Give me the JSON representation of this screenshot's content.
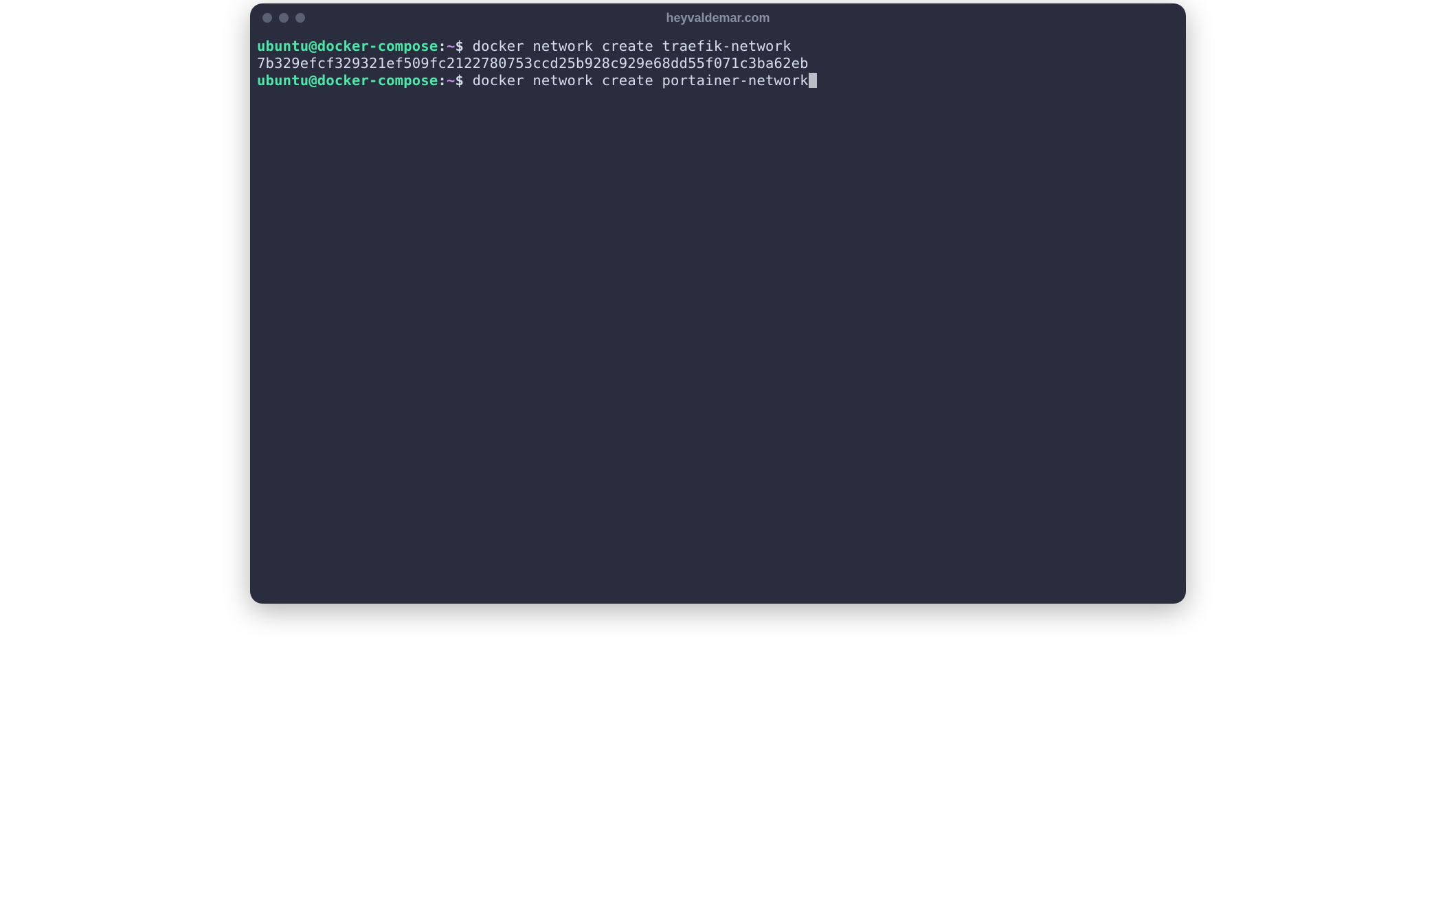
{
  "window": {
    "title": "heyvaldemar.com"
  },
  "terminal": {
    "lines": [
      {
        "user_host": "ubuntu@docker-compose",
        "colon": ":",
        "path": "~",
        "dollar": "$",
        "command": " docker network create traefik-network"
      },
      {
        "output": "7b329efcf329321ef509fc2122780753ccd25b928c929e68dd55f071c3ba62eb"
      },
      {
        "user_host": "ubuntu@docker-compose",
        "colon": ":",
        "path": "~",
        "dollar": "$",
        "command": " docker network create portainer-network",
        "cursor": true
      }
    ]
  }
}
